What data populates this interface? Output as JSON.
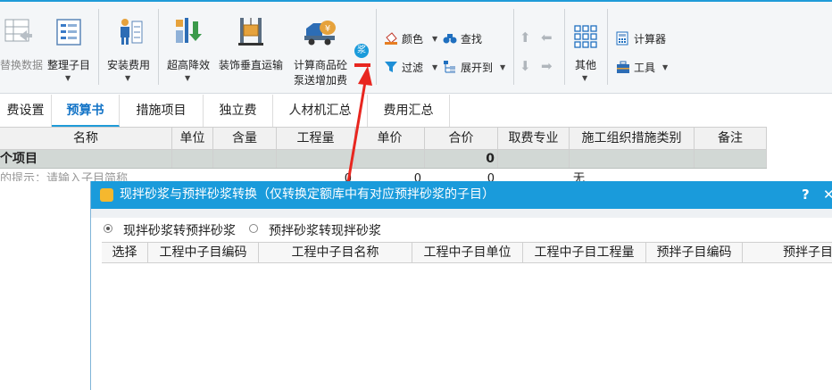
{
  "toolbar": {
    "replace_data": "替换数据",
    "organize_items": "整理子目",
    "install_fee": "安装费用",
    "height_reduction": "超高降效",
    "decor_vertical": "装饰垂直运输",
    "calc_concrete_line1": "计算商品砼",
    "calc_concrete_line2": "泵送增加费",
    "mortar_glyph": "浆",
    "color": "颜色",
    "find": "查找",
    "filter": "过滤",
    "expand_to": "展开到",
    "other": "其他",
    "calculator": "计算器",
    "tools": "工具"
  },
  "tabs": [
    "费设置",
    "预算书",
    "措施项目",
    "独立费",
    "人材机汇总",
    "费用汇总"
  ],
  "active_tab": "预算书",
  "grid": {
    "headers": [
      "名称",
      "单位",
      "含量",
      "工程量",
      "单价",
      "合价",
      "取费专业",
      "施工组织措施类别",
      "备注"
    ],
    "row1": {
      "name": "个项目",
      "total": "0"
    },
    "row2": {
      "hint": "的提示：请输入子目简称",
      "qty": "0",
      "price": "0",
      "total": "0",
      "org": "无"
    }
  },
  "dialog": {
    "title": "现拌砂浆与预拌砂浆转换（仅转换定额库中有对应预拌砂浆的子目）",
    "help": "?",
    "close": "✕",
    "option_a": "现拌砂浆转预拌砂浆",
    "option_b": "预拌砂浆转现拌砂浆",
    "selected_option": "现拌砂浆转预拌砂浆",
    "columns": [
      "选择",
      "工程中子目编码",
      "工程中子目名称",
      "工程中子目单位",
      "工程中子目工程量",
      "预拌子目编码",
      "预拌子目"
    ]
  },
  "colors": {
    "accent": "#1a9bdb",
    "annotation": "#e8261f",
    "row_highlight": "#d2d8d5"
  }
}
